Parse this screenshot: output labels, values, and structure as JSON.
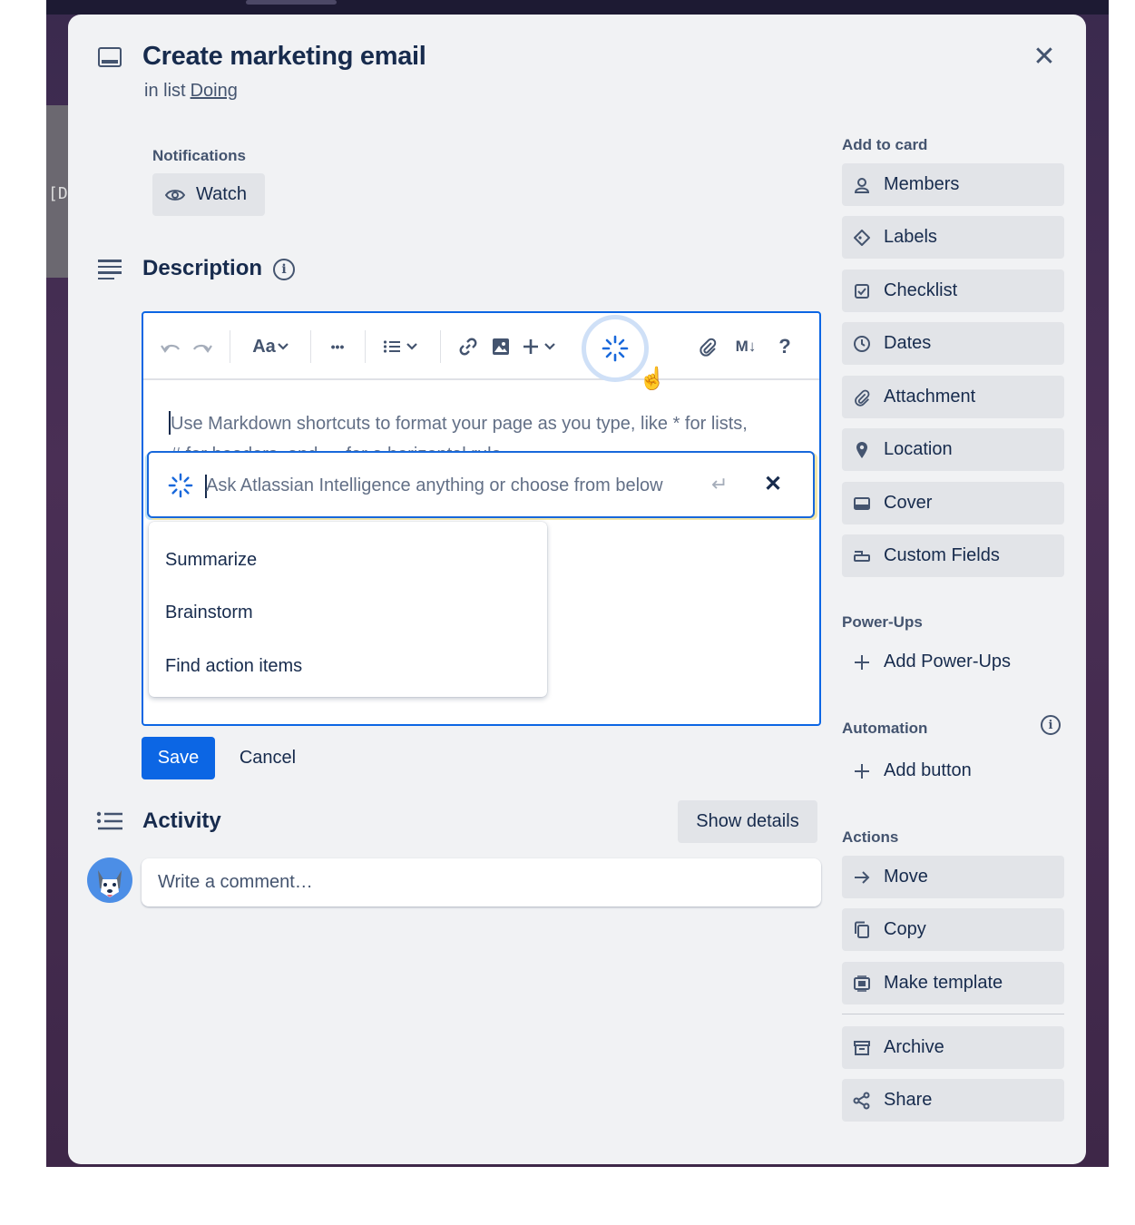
{
  "backdrop": {
    "partial_text": "[D"
  },
  "card": {
    "title": "Create marketing email",
    "list_prefix": "in list",
    "list_name": "Doing",
    "close_glyph": "✕"
  },
  "notifications": {
    "label": "Notifications",
    "watch_label": "Watch"
  },
  "description": {
    "title": "Description",
    "info_glyph": "i",
    "toolbar": {
      "text_style": "Aa",
      "more": "•••",
      "markdown": "M↓",
      "help": "?"
    },
    "placeholder_line1": "Use Markdown shortcuts to format your page as you type, like * for lists,",
    "placeholder_line2": "# for headers, and --- for a horizontal rule.",
    "ai": {
      "placeholder": "Ask Atlassian Intelligence anything or choose from below",
      "enter_glyph": "↵",
      "close_glyph": "✕",
      "options": [
        "Summarize",
        "Brainstorm",
        "Find action items"
      ]
    },
    "save_label": "Save",
    "cancel_label": "Cancel"
  },
  "activity": {
    "title": "Activity",
    "show_details_label": "Show details",
    "comment_placeholder": "Write a comment…"
  },
  "sidebar": {
    "add_to_card_label": "Add to card",
    "add_to_card": [
      {
        "label": "Members",
        "icon": "person-icon"
      },
      {
        "label": "Labels",
        "icon": "tag-icon"
      },
      {
        "label": "Checklist",
        "icon": "checkbox-icon"
      },
      {
        "label": "Dates",
        "icon": "clock-icon"
      },
      {
        "label": "Attachment",
        "icon": "paperclip-icon"
      },
      {
        "label": "Location",
        "icon": "pin-icon"
      },
      {
        "label": "Cover",
        "icon": "card-cover-icon"
      },
      {
        "label": "Custom Fields",
        "icon": "custom-field-icon"
      }
    ],
    "power_ups_label": "Power-Ups",
    "add_power_ups": "Add Power-Ups",
    "automation_label": "Automation",
    "automation_info_glyph": "i",
    "add_button": "Add button",
    "actions_label": "Actions",
    "actions": [
      {
        "label": "Move",
        "icon": "arrow-right-icon"
      },
      {
        "label": "Copy",
        "icon": "copy-icon"
      },
      {
        "label": "Make template",
        "icon": "template-icon"
      },
      {
        "label": "Archive",
        "icon": "archive-icon"
      },
      {
        "label": "Share",
        "icon": "share-icon"
      }
    ]
  },
  "colors": {
    "primary": "#0c66e4",
    "modal_bg": "#f1f2f4",
    "button_bg": "#e2e4e8",
    "text": "#172b4d",
    "subtle_text": "#44546f"
  }
}
